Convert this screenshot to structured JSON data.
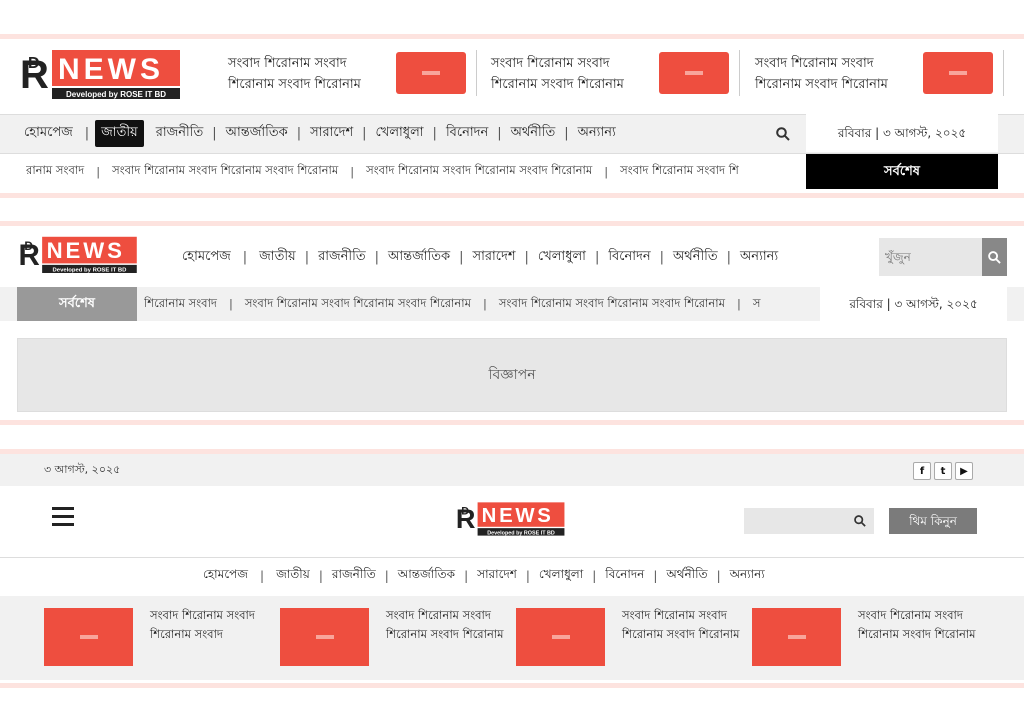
{
  "brand": {
    "logo_text": "NEWS",
    "logo_letters": "PD",
    "tagline": "Developed by ROSE IT BD"
  },
  "colors": {
    "accent": "#ee4e3f",
    "pink_divider": "#fde3df",
    "dark": "#111111",
    "panel": "#f1f1f1"
  },
  "header1": {
    "news": [
      {
        "title": "সংবাদ শিরোনাম সংবাদ শিরোনাম সংবাদ শিরোনাম"
      },
      {
        "title": "সংবাদ শিরোনাম সংবাদ শিরোনাম সংবাদ শিরোনাম"
      },
      {
        "title": "সংবাদ শিরোনাম সংবাদ শিরোনাম সংবাদ শিরোনাম"
      }
    ],
    "nav": [
      "হোমপেজ",
      "জাতীয়",
      "রাজনীতি",
      "আন্তর্জাতিক",
      "সারাদেশ",
      "খেলাধুলা",
      "বিনোদন",
      "অর্থনীতি",
      "অন্যান্য"
    ],
    "active_nav": "জাতীয়",
    "date": "রবিবার | ৩ আগস্ট, ২০২৫",
    "ticker": [
      "রানাম সংবাদ",
      "সংবাদ শিরোনাম সংবাদ শিরোনাম সংবাদ শিরোনাম",
      "সংবাদ শিরোনাম সংবাদ শিরোনাম সংবাদ শিরোনাম",
      "সংবাদ শিরোনাম সংবাদ শি"
    ],
    "latest_label": "সর্বশেষ"
  },
  "header2": {
    "nav": [
      "হোমপেজ",
      "জাতীয়",
      "রাজনীতি",
      "আন্তর্জাতিক",
      "সারাদেশ",
      "খেলাধুলা",
      "বিনোদন",
      "অর্থনীতি",
      "অন্যান্য"
    ],
    "search_placeholder": "খুঁজুন",
    "latest_label": "সর্বশেষ",
    "ticker": [
      "শিরোনাম সংবাদ",
      "সংবাদ শিরোনাম সংবাদ শিরোনাম সংবাদ শিরোনাম",
      "সংবাদ শিরোনাম সংবাদ শিরোনাম সংবাদ শিরোনাম",
      "স"
    ],
    "date": "রবিবার | ৩ আগস্ট, ২০২৫",
    "ad_label": "বিজ্ঞাপন"
  },
  "header3": {
    "date": "৩ আগস্ট, ২০২৫",
    "social": [
      "facebook-icon",
      "twitter-icon",
      "youtube-icon"
    ],
    "buy_label": "থিম কিনুন",
    "nav": [
      "হোমপেজ",
      "জাতীয়",
      "রাজনীতি",
      "আন্তর্জাতিক",
      "সারাদেশ",
      "খেলাধুলা",
      "বিনোদন",
      "অর্থনীতি",
      "অন্যান্য"
    ],
    "news": [
      {
        "title": "সংবাদ শিরোনাম সংবাদ শিরোনাম সংবাদ"
      },
      {
        "title": "সংবাদ শিরোনাম সংবাদ শিরোনাম সংবাদ শিরোনাম"
      },
      {
        "title": "সংবাদ শিরোনাম সংবাদ শিরোনাম সংবাদ শিরোনাম"
      },
      {
        "title": "সংবাদ শিরোনাম সংবাদ শিরোনাম সংবাদ শিরোনাম"
      }
    ]
  }
}
